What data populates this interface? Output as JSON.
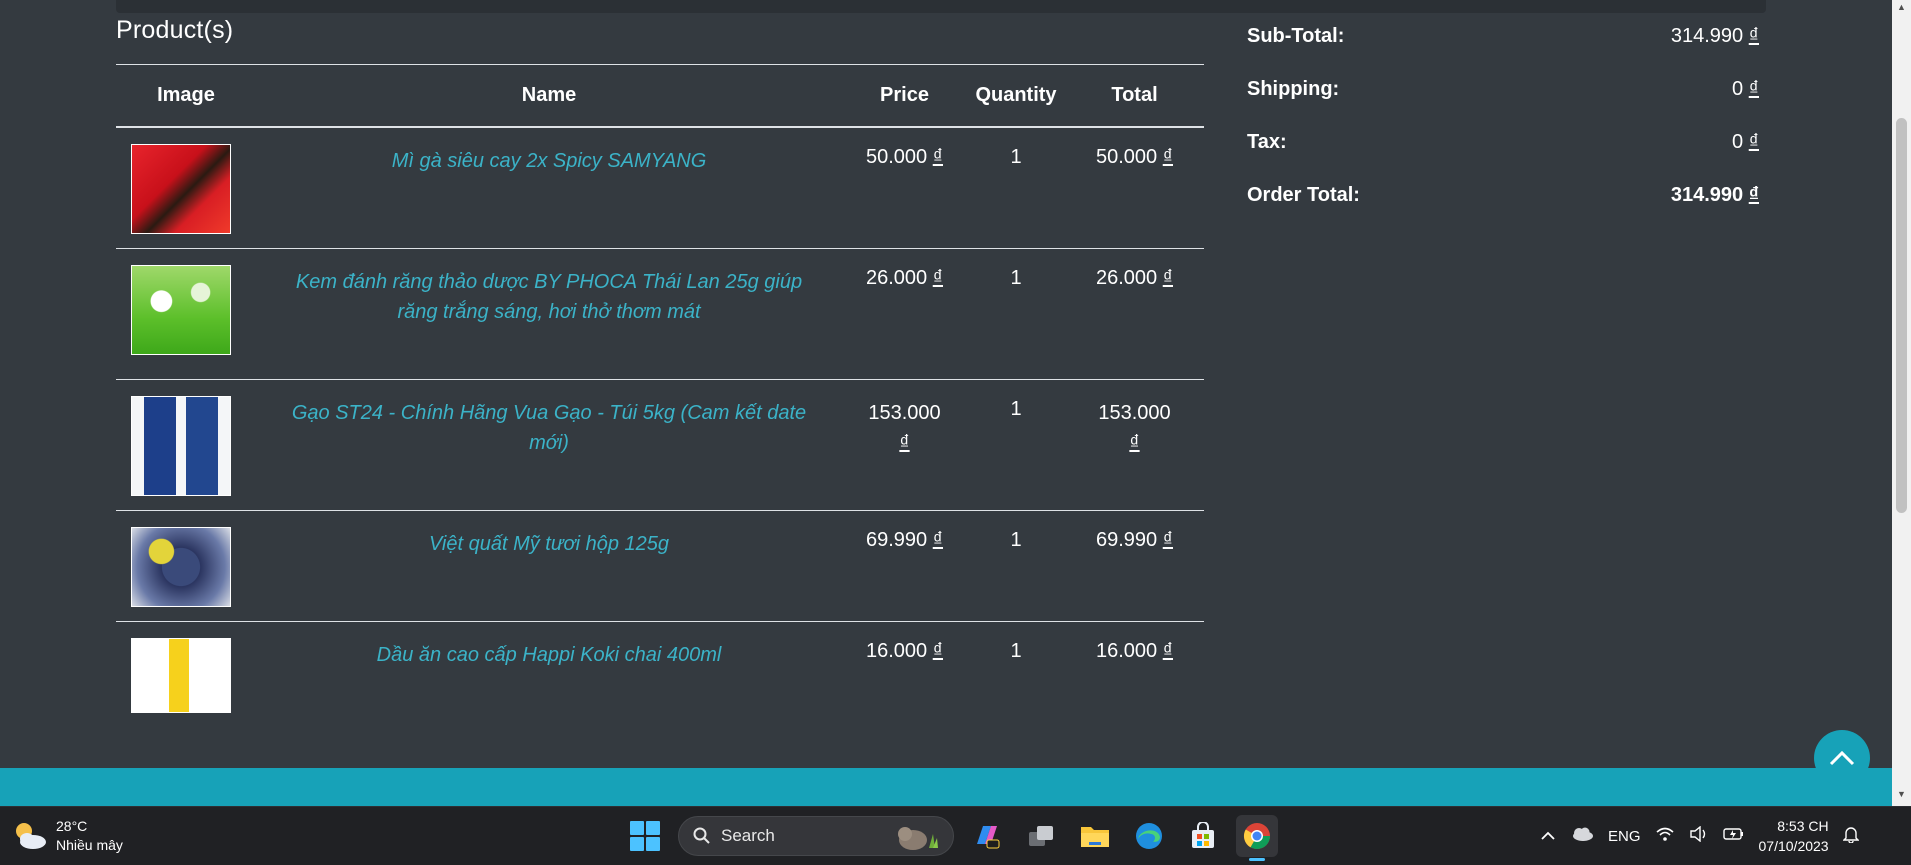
{
  "products_panel": {
    "title": "Product(s)",
    "columns": [
      "Image",
      "Name",
      "Price",
      "Quantity",
      "Total"
    ],
    "rows": [
      {
        "name": "Mì gà siêu cay 2x Spicy SAMYANG",
        "price": "50.000",
        "quantity": "1",
        "total": "50.000",
        "thumb": "noodle-pack-image"
      },
      {
        "name": "Kem đánh răng thảo dược BY PHOCA Thái Lan 25g giúp răng trắng sáng, hơi thở thơm mát",
        "price": "26.000",
        "quantity": "1",
        "total": "26.000",
        "thumb": "toothpaste-image"
      },
      {
        "name": "Gạo ST24 - Chính Hãng Vua Gạo - Túi 5kg (Cam kết date mới)",
        "price": "153.000",
        "quantity": "1",
        "total": "153.000",
        "thumb": "rice-bag-image"
      },
      {
        "name": "Việt quất Mỹ tươi hộp 125g",
        "price": "69.990",
        "quantity": "1",
        "total": "69.990",
        "thumb": "blueberry-box-image"
      },
      {
        "name": "Dầu ăn cao cấp Happi Koki chai 400ml",
        "price": "16.000",
        "quantity": "1",
        "total": "16.000",
        "thumb": "cooking-oil-bottle-image"
      }
    ],
    "currency": "₫"
  },
  "summary": {
    "subtotal_label": "Sub-Total:",
    "subtotal_value": "314.990",
    "shipping_label": "Shipping:",
    "shipping_value": "0",
    "tax_label": "Tax:",
    "tax_value": "0",
    "total_label": "Order Total:",
    "total_value": "314.990",
    "currency": "₫"
  },
  "taskbar": {
    "weather_temp": "28°C",
    "weather_desc": "Nhiều mây",
    "search_label": "Search",
    "language": "ENG",
    "time": "8:53 CH",
    "date": "07/10/2023"
  },
  "colors": {
    "background": "#343a40",
    "link": "#3bb3c8",
    "accent": "#17a2b8",
    "taskbar": "#202124"
  }
}
